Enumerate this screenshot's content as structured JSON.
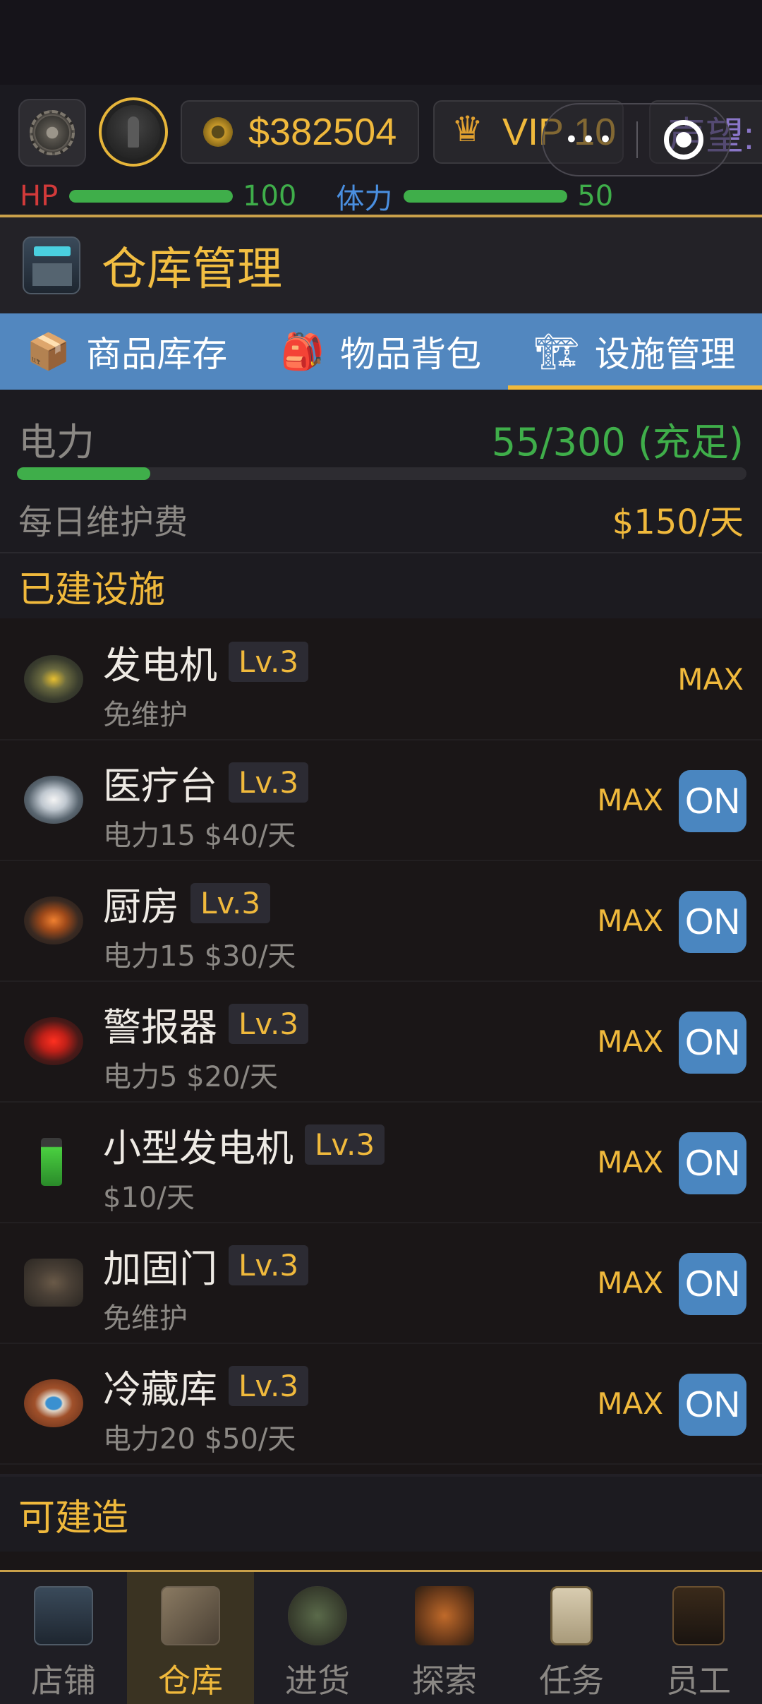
{
  "topbar": {
    "money": "$382504",
    "vip": "VIP 10",
    "reputation_label": "声望:",
    "hp_label": "HP",
    "hp_value": "100",
    "hp_fraction": 1.0,
    "stamina_label": "体力",
    "stamina_value": "50",
    "stamina_fraction": 1.0,
    "menu_dots": "•••"
  },
  "header": {
    "title": "仓库管理"
  },
  "tabs": [
    {
      "icon": "box-icon",
      "label": "商品库存",
      "active": false
    },
    {
      "icon": "backpack-icon",
      "label": "物品背包",
      "active": false
    },
    {
      "icon": "crane-icon",
      "label": "设施管理",
      "active": true
    }
  ],
  "power": {
    "label": "电力",
    "value": "55/300 (充足)",
    "fraction": 0.183,
    "maintenance_label": "每日维护费",
    "maintenance_value": "$150/天"
  },
  "built_section": {
    "title": "已建设施"
  },
  "facilities": [
    {
      "name": "发电机",
      "level": "Lv.3",
      "sub": "免维护",
      "max": "MAX",
      "toggle": ""
    },
    {
      "name": "医疗台",
      "level": "Lv.3",
      "sub": "电力15 $40/天",
      "max": "MAX",
      "toggle": "ON"
    },
    {
      "name": "厨房",
      "level": "Lv.3",
      "sub": "电力15 $30/天",
      "max": "MAX",
      "toggle": "ON"
    },
    {
      "name": "警报器",
      "level": "Lv.3",
      "sub": "电力5 $20/天",
      "max": "MAX",
      "toggle": "ON"
    },
    {
      "name": "小型发电机",
      "level": "Lv.3",
      "sub": "$10/天",
      "max": "MAX",
      "toggle": "ON"
    },
    {
      "name": "加固门",
      "level": "Lv.3",
      "sub": "免维护",
      "max": "MAX",
      "toggle": "ON"
    },
    {
      "name": "冷藏库",
      "level": "Lv.3",
      "sub": "电力20 $50/天",
      "max": "MAX",
      "toggle": "ON"
    }
  ],
  "buildable_section": {
    "title": "可建造"
  },
  "bottom_nav": [
    {
      "label": "店铺",
      "active": false
    },
    {
      "label": "仓库",
      "active": true
    },
    {
      "label": "进货",
      "active": false
    },
    {
      "label": "探索",
      "active": false
    },
    {
      "label": "任务",
      "active": false
    },
    {
      "label": "员工",
      "active": false
    }
  ],
  "colors": {
    "accent_gold": "#f0b93c",
    "tab_blue": "#5287bf",
    "button_blue": "#4a86c0",
    "hp_red": "#d23a3a",
    "stamina_blue": "#4a8fe0",
    "bar_green": "#3fae4a"
  }
}
